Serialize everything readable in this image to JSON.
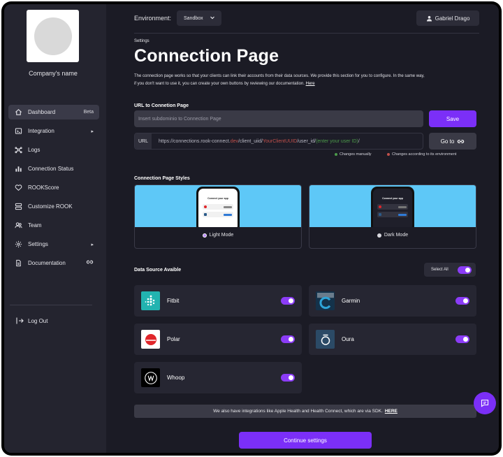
{
  "sidebar": {
    "company_name": "Company's name",
    "items": [
      {
        "label": "Dashboard",
        "badge": "Beta",
        "icon": "home-icon",
        "active": true
      },
      {
        "label": "Integration",
        "icon": "integration-icon",
        "chevron": "▸"
      },
      {
        "label": "Logs",
        "icon": "logs-icon"
      },
      {
        "label": "Connection Status",
        "icon": "bar-chart-icon"
      },
      {
        "label": "ROOKScore",
        "icon": "heart-icon"
      },
      {
        "label": "Customize ROOK",
        "icon": "customize-icon"
      },
      {
        "label": "Team",
        "icon": "team-icon"
      },
      {
        "label": "Settings",
        "icon": "gear-icon",
        "chevron": "▸"
      },
      {
        "label": "Documentation",
        "icon": "document-icon"
      }
    ],
    "logout": "Log Out"
  },
  "topbar": {
    "environment_label": "Environment:",
    "environment_value": "Sandbox",
    "user_name": "Gabriel Drago"
  },
  "page": {
    "breadcrumb": "Settings",
    "title": "Connection Page",
    "description": "The connection page works so that your clients can link their accounts from their data sources. We provide this section for you to configure. In the same way, if you don't want to use it, you can create your own buttons by reviewing our documentation.",
    "description_link": "Here"
  },
  "url_section": {
    "label": "URL to Connetion Page",
    "subdomain_placeholder": "Insert subdominio to Connection Page",
    "save_label": "Save",
    "url_tag": "URL",
    "url_parts": {
      "base": "https://connections.rook-connect.",
      "tld": "dev",
      "client": "/client_uiid/",
      "client_var": "YourClientUUID",
      "user": "/user_id/",
      "user_var": "(enter your user ID)",
      "end": "/"
    },
    "goto_label": "Go to",
    "legend_manual": "Changes manually",
    "legend_env": "Changes according to its environment",
    "colors": {
      "manual": "#4c9a4a",
      "env": "#c0504b"
    }
  },
  "styles_section": {
    "label": "Connection Page Styles",
    "phone_title": "Connect your app",
    "light_label": "Light Mode",
    "dark_label": "Dark Mode"
  },
  "data_sources": {
    "label": "Data Source Avaible",
    "select_all": "Select All",
    "items": [
      {
        "name": "Fitbit",
        "enabled": true
      },
      {
        "name": "Garmin",
        "enabled": true
      },
      {
        "name": "Polar",
        "enabled": true
      },
      {
        "name": "Oura",
        "enabled": true
      },
      {
        "name": "Whoop",
        "enabled": true
      }
    ]
  },
  "sdk_notice": {
    "text": "We also have integrations like Apple Health and Health Connect, which are via SDK.",
    "link": "HERE"
  },
  "continue_label": "Continue settings",
  "accent": "#7b2ff7"
}
